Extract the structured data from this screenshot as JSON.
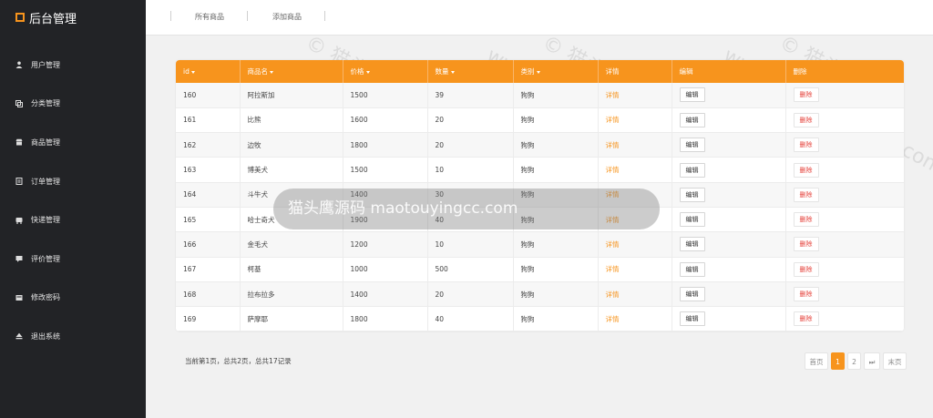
{
  "brand": {
    "title": "后台管理"
  },
  "sidebar": {
    "items": [
      {
        "label": "用户管理",
        "icon": "user-icon"
      },
      {
        "label": "分类管理",
        "icon": "category-icon"
      },
      {
        "label": "商品管理",
        "icon": "shop-icon"
      },
      {
        "label": "订单管理",
        "icon": "order-icon"
      },
      {
        "label": "快递管理",
        "icon": "truck-icon"
      },
      {
        "label": "评价管理",
        "icon": "comment-icon"
      },
      {
        "label": "修改密码",
        "icon": "password-icon"
      },
      {
        "label": "退出系统",
        "icon": "logout-icon"
      }
    ]
  },
  "topbar": {
    "tabs": [
      "所有商品",
      "添加商品"
    ]
  },
  "table": {
    "columns": [
      "id",
      "商品名",
      "价格",
      "数量",
      "类别",
      "详情",
      "编辑",
      "删除"
    ],
    "detail_label": "详情",
    "edit_label": "编辑",
    "delete_label": "删除",
    "rows": [
      [
        "160",
        "阿拉斯加",
        "1500",
        "39",
        "狗狗"
      ],
      [
        "161",
        "比熊",
        "1600",
        "20",
        "狗狗"
      ],
      [
        "162",
        "边牧",
        "1800",
        "20",
        "狗狗"
      ],
      [
        "163",
        "博美犬",
        "1500",
        "10",
        "狗狗"
      ],
      [
        "164",
        "斗牛犬",
        "1400",
        "30",
        "狗狗"
      ],
      [
        "165",
        "哈士奇犬",
        "1900",
        "40",
        "狗狗"
      ],
      [
        "166",
        "金毛犬",
        "1200",
        "10",
        "狗狗"
      ],
      [
        "167",
        "柯基",
        "1000",
        "500",
        "狗狗"
      ],
      [
        "168",
        "拉布拉多",
        "1400",
        "20",
        "狗狗"
      ],
      [
        "169",
        "萨摩耶",
        "1800",
        "40",
        "狗狗"
      ]
    ]
  },
  "footer": {
    "page_info": "当前第1页，总共2页，总共17记录"
  },
  "pagination": {
    "first": "首页",
    "pages": [
      "1",
      "2"
    ],
    "current": "1",
    "next": "⏭",
    "last": "末页"
  },
  "watermark": {
    "text": "© 猫头鹰源码",
    "url": "www.maotouyingcc.com",
    "banner": "猫头鹰源码 maotouyingcc.com"
  },
  "colors": {
    "accent": "#f7941d",
    "sidebar": "#222326",
    "danger": "#e5413a"
  }
}
